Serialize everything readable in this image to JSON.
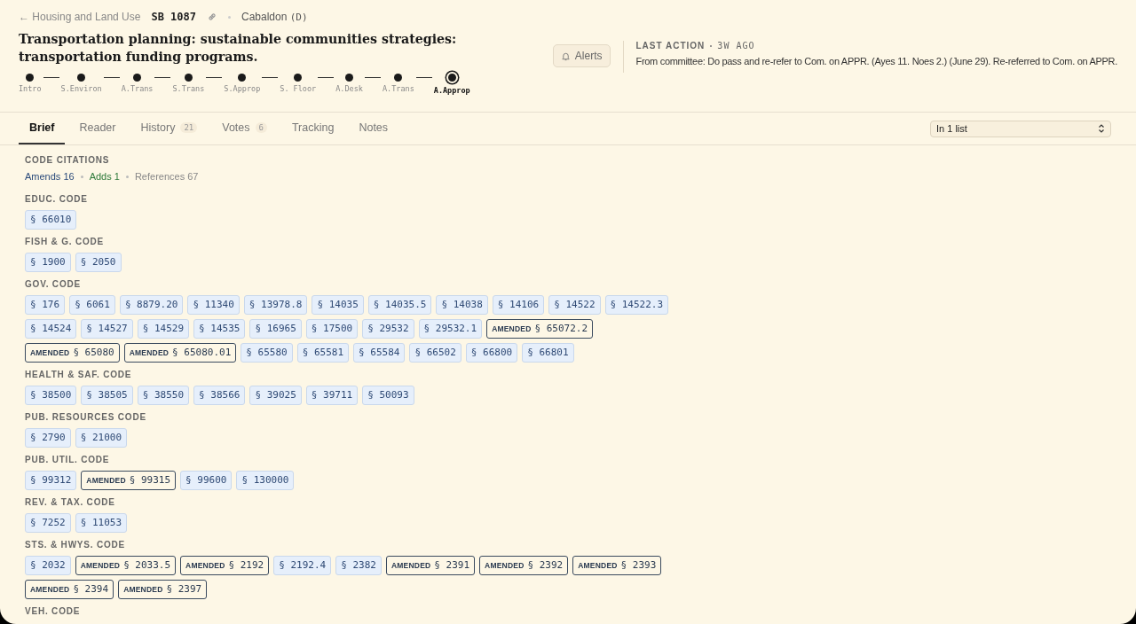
{
  "breadcrumb": {
    "back": "← Housing and Land Use",
    "bill": "SB 1087",
    "author": "Cabaldon",
    "party": "(D)"
  },
  "title": "Transportation planning: sustainable communities strategies: transportation funding programs.",
  "steps": [
    {
      "label": "Intro",
      "selected": false
    },
    {
      "label": "S.Environ",
      "selected": false
    },
    {
      "label": "A.Trans",
      "selected": false
    },
    {
      "label": "S.Trans",
      "selected": false
    },
    {
      "label": "S.Approp",
      "selected": false
    },
    {
      "label": "S. Floor",
      "selected": false
    },
    {
      "label": "A.Desk",
      "selected": false
    },
    {
      "label": "A.Trans",
      "selected": false
    },
    {
      "label": "A.Approp",
      "selected": true
    }
  ],
  "alerts_button": "Alerts",
  "last_action": {
    "label": "LAST ACTION",
    "age": "3W AGO",
    "text": "From committee: Do pass and re-refer to Com. on APPR. (Ayes 11. Noes 2.) (June 29). Re-referred to Com. on APPR."
  },
  "tabs": [
    {
      "label": "Brief",
      "selected": true
    },
    {
      "label": "Reader",
      "selected": false
    },
    {
      "label": "History",
      "count": "21",
      "selected": false
    },
    {
      "label": "Votes",
      "count": "6",
      "selected": false
    },
    {
      "label": "Tracking",
      "selected": false
    },
    {
      "label": "Notes",
      "selected": false
    }
  ],
  "list_select": {
    "value": "In 1 list"
  },
  "code_citations": {
    "heading": "CODE CITATIONS",
    "summary": [
      {
        "kind": "amends",
        "text": "Amends 16"
      },
      {
        "kind": "adds",
        "text": "Adds 1"
      },
      {
        "kind": "references",
        "text": "References 67"
      }
    ],
    "groups": [
      {
        "name": "EDUC. CODE",
        "sections": [
          {
            "kind": "reference",
            "text": "§ 66010"
          }
        ]
      },
      {
        "name": "FISH & G. CODE",
        "sections": [
          {
            "kind": "reference",
            "text": "§ 1900"
          },
          {
            "kind": "reference",
            "text": "§ 2050"
          }
        ]
      },
      {
        "name": "GOV. CODE",
        "sections": [
          {
            "kind": "reference",
            "text": "§ 176"
          },
          {
            "kind": "reference",
            "text": "§ 6061"
          },
          {
            "kind": "reference",
            "text": "§ 8879.20"
          },
          {
            "kind": "reference",
            "text": "§ 11340"
          },
          {
            "kind": "reference",
            "text": "§ 13978.8"
          },
          {
            "kind": "reference",
            "text": "§ 14035"
          },
          {
            "kind": "reference",
            "text": "§ 14035.5"
          },
          {
            "kind": "reference",
            "text": "§ 14038"
          },
          {
            "kind": "reference",
            "text": "§ 14106"
          },
          {
            "kind": "reference",
            "text": "§ 14522"
          },
          {
            "kind": "reference",
            "text": "§ 14522.3"
          },
          {
            "kind": "reference",
            "text": "§ 14524"
          },
          {
            "kind": "reference",
            "text": "§ 14527"
          },
          {
            "kind": "reference",
            "text": "§ 14529"
          },
          {
            "kind": "reference",
            "text": "§ 14535"
          },
          {
            "kind": "reference",
            "text": "§ 16965"
          },
          {
            "kind": "reference",
            "text": "§ 17500"
          },
          {
            "kind": "reference",
            "text": "§ 29532"
          },
          {
            "kind": "reference",
            "text": "§ 29532.1"
          },
          {
            "kind": "amended",
            "tag": "AMENDED",
            "text": "§ 65072.2"
          },
          {
            "kind": "amended",
            "tag": "AMENDED",
            "text": "§ 65080"
          },
          {
            "kind": "amended",
            "tag": "AMENDED",
            "text": "§ 65080.01"
          },
          {
            "kind": "reference",
            "text": "§ 65580"
          },
          {
            "kind": "reference",
            "text": "§ 65581"
          },
          {
            "kind": "reference",
            "text": "§ 65584"
          },
          {
            "kind": "reference",
            "text": "§ 66502"
          },
          {
            "kind": "reference",
            "text": "§ 66800"
          },
          {
            "kind": "reference",
            "text": "§ 66801"
          }
        ]
      },
      {
        "name": "HEALTH & SAF. CODE",
        "sections": [
          {
            "kind": "reference",
            "text": "§ 38500"
          },
          {
            "kind": "reference",
            "text": "§ 38505"
          },
          {
            "kind": "reference",
            "text": "§ 38550"
          },
          {
            "kind": "reference",
            "text": "§ 38566"
          },
          {
            "kind": "reference",
            "text": "§ 39025"
          },
          {
            "kind": "reference",
            "text": "§ 39711"
          },
          {
            "kind": "reference",
            "text": "§ 50093"
          }
        ]
      },
      {
        "name": "PUB. RESOURCES CODE",
        "sections": [
          {
            "kind": "reference",
            "text": "§ 2790"
          },
          {
            "kind": "reference",
            "text": "§ 21000"
          }
        ]
      },
      {
        "name": "PUB. UTIL. CODE",
        "sections": [
          {
            "kind": "reference",
            "text": "§ 99312"
          },
          {
            "kind": "amended",
            "tag": "AMENDED",
            "text": "§ 99315"
          },
          {
            "kind": "reference",
            "text": "§ 99600"
          },
          {
            "kind": "reference",
            "text": "§ 130000"
          }
        ]
      },
      {
        "name": "REV. & TAX. CODE",
        "sections": [
          {
            "kind": "reference",
            "text": "§ 7252"
          },
          {
            "kind": "reference",
            "text": "§ 11053"
          }
        ]
      },
      {
        "name": "STS. & HWYS. CODE",
        "sections": [
          {
            "kind": "reference",
            "text": "§ 2032"
          },
          {
            "kind": "amended",
            "tag": "AMENDED",
            "text": "§ 2033.5"
          },
          {
            "kind": "amended",
            "tag": "AMENDED",
            "text": "§ 2192"
          },
          {
            "kind": "reference",
            "text": "§ 2192.4"
          },
          {
            "kind": "reference",
            "text": "§ 2382"
          },
          {
            "kind": "amended",
            "tag": "AMENDED",
            "text": "§ 2391"
          },
          {
            "kind": "amended",
            "tag": "AMENDED",
            "text": "§ 2392"
          },
          {
            "kind": "amended",
            "tag": "AMENDED",
            "text": "§ 2393"
          },
          {
            "kind": "amended",
            "tag": "AMENDED",
            "text": "§ 2394"
          },
          {
            "kind": "amended",
            "tag": "AMENDED",
            "text": "§ 2397"
          }
        ]
      },
      {
        "name": "VEH. CODE"
      }
    ]
  }
}
